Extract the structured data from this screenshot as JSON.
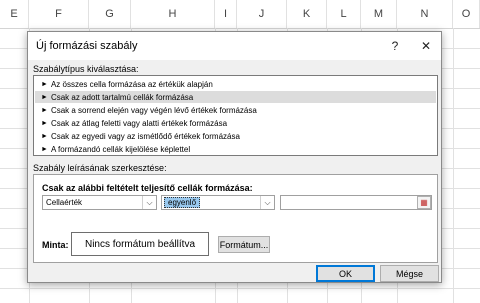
{
  "sheet": {
    "columns": [
      "E",
      "F",
      "G",
      "H",
      "I",
      "J",
      "K",
      "L",
      "M",
      "N",
      "O"
    ]
  },
  "dialog": {
    "title": "Új formázási szabály",
    "help_label": "?",
    "close_label": "✕",
    "rule_type_heading": "Szabálytípus kiválasztása:",
    "rule_types": [
      "Az összes cella formázása az értékük alapján",
      "Csak az adott tartalmú cellák formázása",
      "Csak a sorrend elején vagy végén lévő értékek formázása",
      "Csak az átlag feletti vagy alatti értékek formázása",
      "Csak az egyedi vagy az ismétlődő értékek formázása",
      "A formázandó cellák kijelölése képlettel"
    ],
    "selected_rule_index": 1,
    "description_heading": "Szabály leírásának szerkesztése:",
    "condition_heading": "Csak az alábbi feltételt teljesítő cellák formázása:",
    "condition_field": "Cellaérték",
    "condition_operator": "egyenlő",
    "condition_value": "",
    "preview_label": "Minta:",
    "preview_text": "Nincs formátum beállítva",
    "format_button": "Formátum...",
    "ok_button": "OK",
    "cancel_button": "Mégse"
  },
  "colors": {
    "selection_highlight": "#99c9ef",
    "default_button_border": "#0078d7"
  },
  "icons": {
    "rule_bullet": "right-triangle-icon",
    "dropdown": "chevron-down-icon",
    "range_picker": "range-picker-icon"
  }
}
